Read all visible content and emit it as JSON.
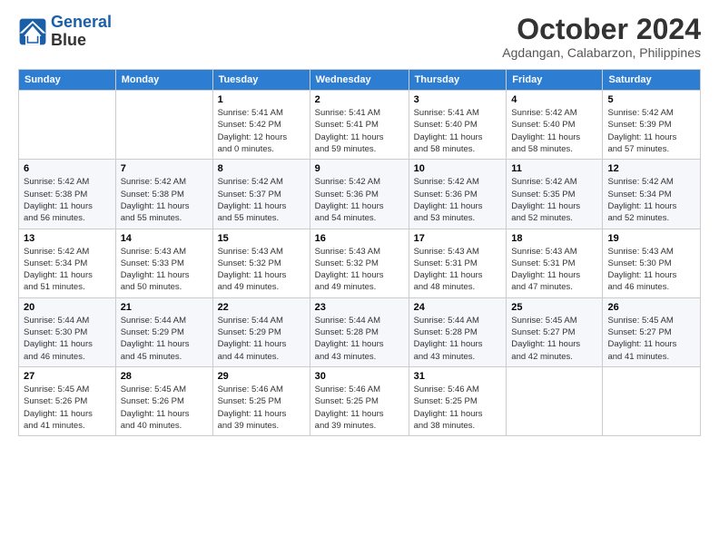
{
  "header": {
    "logo_line1": "General",
    "logo_line2": "Blue",
    "month_title": "October 2024",
    "location": "Agdangan, Calabarzon, Philippines"
  },
  "weekdays": [
    "Sunday",
    "Monday",
    "Tuesday",
    "Wednesday",
    "Thursday",
    "Friday",
    "Saturday"
  ],
  "weeks": [
    [
      {
        "day": "",
        "info": ""
      },
      {
        "day": "",
        "info": ""
      },
      {
        "day": "1",
        "info": "Sunrise: 5:41 AM\nSunset: 5:42 PM\nDaylight: 12 hours\nand 0 minutes."
      },
      {
        "day": "2",
        "info": "Sunrise: 5:41 AM\nSunset: 5:41 PM\nDaylight: 11 hours\nand 59 minutes."
      },
      {
        "day": "3",
        "info": "Sunrise: 5:41 AM\nSunset: 5:40 PM\nDaylight: 11 hours\nand 58 minutes."
      },
      {
        "day": "4",
        "info": "Sunrise: 5:42 AM\nSunset: 5:40 PM\nDaylight: 11 hours\nand 58 minutes."
      },
      {
        "day": "5",
        "info": "Sunrise: 5:42 AM\nSunset: 5:39 PM\nDaylight: 11 hours\nand 57 minutes."
      }
    ],
    [
      {
        "day": "6",
        "info": "Sunrise: 5:42 AM\nSunset: 5:38 PM\nDaylight: 11 hours\nand 56 minutes."
      },
      {
        "day": "7",
        "info": "Sunrise: 5:42 AM\nSunset: 5:38 PM\nDaylight: 11 hours\nand 55 minutes."
      },
      {
        "day": "8",
        "info": "Sunrise: 5:42 AM\nSunset: 5:37 PM\nDaylight: 11 hours\nand 55 minutes."
      },
      {
        "day": "9",
        "info": "Sunrise: 5:42 AM\nSunset: 5:36 PM\nDaylight: 11 hours\nand 54 minutes."
      },
      {
        "day": "10",
        "info": "Sunrise: 5:42 AM\nSunset: 5:36 PM\nDaylight: 11 hours\nand 53 minutes."
      },
      {
        "day": "11",
        "info": "Sunrise: 5:42 AM\nSunset: 5:35 PM\nDaylight: 11 hours\nand 52 minutes."
      },
      {
        "day": "12",
        "info": "Sunrise: 5:42 AM\nSunset: 5:34 PM\nDaylight: 11 hours\nand 52 minutes."
      }
    ],
    [
      {
        "day": "13",
        "info": "Sunrise: 5:42 AM\nSunset: 5:34 PM\nDaylight: 11 hours\nand 51 minutes."
      },
      {
        "day": "14",
        "info": "Sunrise: 5:43 AM\nSunset: 5:33 PM\nDaylight: 11 hours\nand 50 minutes."
      },
      {
        "day": "15",
        "info": "Sunrise: 5:43 AM\nSunset: 5:32 PM\nDaylight: 11 hours\nand 49 minutes."
      },
      {
        "day": "16",
        "info": "Sunrise: 5:43 AM\nSunset: 5:32 PM\nDaylight: 11 hours\nand 49 minutes."
      },
      {
        "day": "17",
        "info": "Sunrise: 5:43 AM\nSunset: 5:31 PM\nDaylight: 11 hours\nand 48 minutes."
      },
      {
        "day": "18",
        "info": "Sunrise: 5:43 AM\nSunset: 5:31 PM\nDaylight: 11 hours\nand 47 minutes."
      },
      {
        "day": "19",
        "info": "Sunrise: 5:43 AM\nSunset: 5:30 PM\nDaylight: 11 hours\nand 46 minutes."
      }
    ],
    [
      {
        "day": "20",
        "info": "Sunrise: 5:44 AM\nSunset: 5:30 PM\nDaylight: 11 hours\nand 46 minutes."
      },
      {
        "day": "21",
        "info": "Sunrise: 5:44 AM\nSunset: 5:29 PM\nDaylight: 11 hours\nand 45 minutes."
      },
      {
        "day": "22",
        "info": "Sunrise: 5:44 AM\nSunset: 5:29 PM\nDaylight: 11 hours\nand 44 minutes."
      },
      {
        "day": "23",
        "info": "Sunrise: 5:44 AM\nSunset: 5:28 PM\nDaylight: 11 hours\nand 43 minutes."
      },
      {
        "day": "24",
        "info": "Sunrise: 5:44 AM\nSunset: 5:28 PM\nDaylight: 11 hours\nand 43 minutes."
      },
      {
        "day": "25",
        "info": "Sunrise: 5:45 AM\nSunset: 5:27 PM\nDaylight: 11 hours\nand 42 minutes."
      },
      {
        "day": "26",
        "info": "Sunrise: 5:45 AM\nSunset: 5:27 PM\nDaylight: 11 hours\nand 41 minutes."
      }
    ],
    [
      {
        "day": "27",
        "info": "Sunrise: 5:45 AM\nSunset: 5:26 PM\nDaylight: 11 hours\nand 41 minutes."
      },
      {
        "day": "28",
        "info": "Sunrise: 5:45 AM\nSunset: 5:26 PM\nDaylight: 11 hours\nand 40 minutes."
      },
      {
        "day": "29",
        "info": "Sunrise: 5:46 AM\nSunset: 5:25 PM\nDaylight: 11 hours\nand 39 minutes."
      },
      {
        "day": "30",
        "info": "Sunrise: 5:46 AM\nSunset: 5:25 PM\nDaylight: 11 hours\nand 39 minutes."
      },
      {
        "day": "31",
        "info": "Sunrise: 5:46 AM\nSunset: 5:25 PM\nDaylight: 11 hours\nand 38 minutes."
      },
      {
        "day": "",
        "info": ""
      },
      {
        "day": "",
        "info": ""
      }
    ]
  ]
}
